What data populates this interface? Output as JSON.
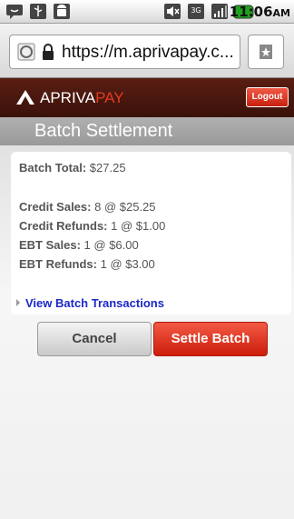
{
  "status_bar": {
    "icons": [
      "chat-icon",
      "usb-icon",
      "android-debug-icon",
      "mute-icon",
      "3g-icon",
      "signal-icon",
      "battery-icon"
    ],
    "time": "11:06",
    "ampm": "AM"
  },
  "browser": {
    "url": "https://m.aprivapay.c...",
    "icons": [
      "site-icon",
      "lock-icon",
      "bookmark-icon"
    ]
  },
  "header": {
    "brand_main": "APRIVA",
    "brand_accent": "PAY",
    "logout_label": "Logout"
  },
  "page": {
    "title": "Batch Settlement"
  },
  "summary": {
    "batch_total_label": "Batch Total:",
    "batch_total_value": "$27.25",
    "rows": [
      {
        "label": "Credit Sales:",
        "value": "8 @ $25.25"
      },
      {
        "label": "Credit Refunds:",
        "value": "1 @ $1.00"
      },
      {
        "label": "EBT Sales:",
        "value": "1 @ $6.00"
      },
      {
        "label": "EBT Refunds:",
        "value": "1 @ $3.00"
      }
    ],
    "view_link": "View Batch Transactions"
  },
  "actions": {
    "cancel_label": "Cancel",
    "settle_label": "Settle Batch"
  },
  "colors": {
    "header_bg": "#4a160d",
    "accent_red": "#e33a22",
    "link_blue": "#1a27c8"
  }
}
